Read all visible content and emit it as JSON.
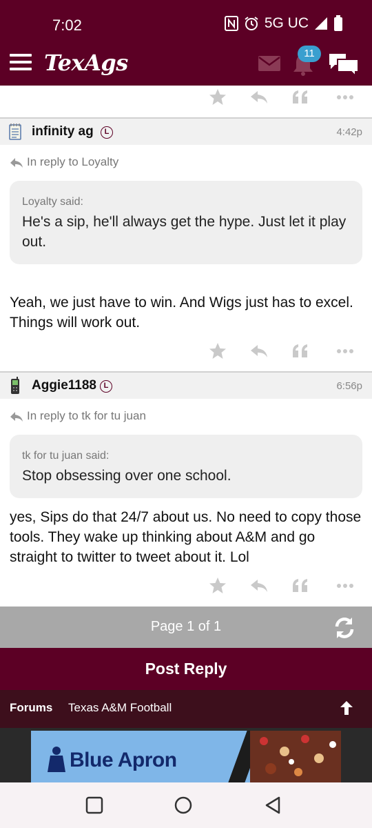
{
  "status_bar": {
    "time": "7:02",
    "network": "5G UC"
  },
  "app": {
    "logo": "TexAgs",
    "notification_count": "11"
  },
  "posts": [
    {
      "username": "infinity ag",
      "badge": "L",
      "time": "4:42p",
      "device_icon": "notepad-icon",
      "reply_to": "In reply to Loyalty",
      "quote_said": "Loyalty said:",
      "quote_text": "He's a sip, he'll always get the hype. Just let it play out.",
      "body": "Yeah, we just have to win. And Wigs just has to excel. Things will work out."
    },
    {
      "username": "Aggie1188",
      "badge": "L",
      "time": "6:56p",
      "device_icon": "phone-icon",
      "reply_to": "In reply to tk for tu juan",
      "quote_said": "tk for tu juan said:",
      "quote_text": "Stop obsessing over one school.",
      "body": "yes, Sips do that 24/7 about us. No need to copy those tools. They wake up thinking about A&M and go straight to twitter to tweet about it. Lol"
    }
  ],
  "pager": {
    "text": "Page 1 of 1"
  },
  "post_reply_label": "Post Reply",
  "breadcrumb": {
    "forums": "Forums",
    "board": "Texas A&M Football"
  },
  "ad": {
    "brand": "Blue Apron"
  },
  "colors": {
    "maroon": "#5c0025",
    "dark_maroon": "#3d0f1c",
    "badge_blue": "#3a9fcf",
    "pager_gray": "#a8a8a8"
  }
}
